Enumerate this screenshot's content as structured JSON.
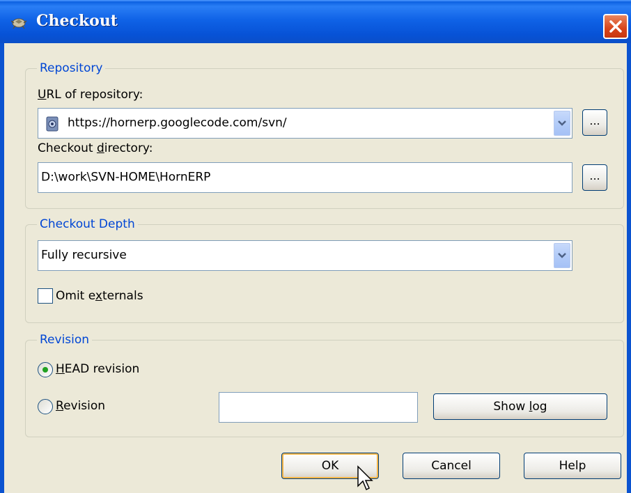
{
  "window": {
    "title": "Checkout",
    "icon": "tortoisesvn-icon",
    "close_icon": "close-icon"
  },
  "repository": {
    "legend": "Repository",
    "url_label": "URL of repository:",
    "url_value": "https://hornerp.googlecode.com/svn/",
    "browse_label": "...",
    "dir_label": "Checkout directory:",
    "dir_value": "D:\\work\\SVN-HOME\\HornERP"
  },
  "depth": {
    "legend": "Checkout Depth",
    "value": "Fully recursive",
    "omit_externals": "Omit externals",
    "omit_checked": false
  },
  "revision": {
    "legend": "Revision",
    "head_label": "HEAD revision",
    "head_selected": true,
    "revision_label": "Revision",
    "revision_value": "",
    "show_log": "Show log"
  },
  "buttons": {
    "ok": "OK",
    "cancel": "Cancel",
    "help": "Help"
  },
  "colors": {
    "title_bar": "#0a5fe0",
    "legend_text": "#0046d5",
    "dialog_bg": "#ece9d8"
  }
}
